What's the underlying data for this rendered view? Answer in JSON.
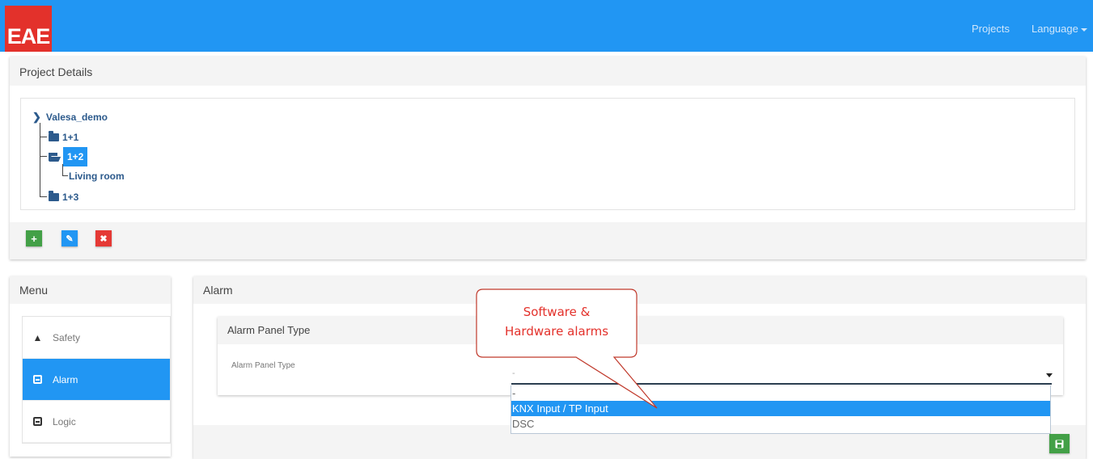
{
  "brand": {
    "logo_text": "EAE",
    "logo_color": "#e3312b",
    "navbar_color": "#2196f3"
  },
  "nav": {
    "projects": "Projects",
    "language": "Language"
  },
  "project_details": {
    "title": "Project Details",
    "tree": {
      "root": "Valesa_demo",
      "items": [
        {
          "label": "1+1"
        },
        {
          "label": "1+2",
          "selected": true
        },
        {
          "label": "Living room"
        },
        {
          "label": "1+3"
        }
      ]
    },
    "buttons": {
      "add": "+",
      "edit": "✎",
      "delete": "✖"
    }
  },
  "menu": {
    "title": "Menu",
    "items": [
      {
        "label": "Safety",
        "icon": "warning-icon"
      },
      {
        "label": "Alarm",
        "icon": "alarm-icon",
        "active": true
      },
      {
        "label": "Logic",
        "icon": "logic-icon"
      }
    ]
  },
  "alarm": {
    "title": "Alarm",
    "panel_title": "Alarm Panel Type",
    "field_label": "Alarm Panel Type",
    "selected_value": "-",
    "options": [
      "-",
      "KNX Input / TP Input",
      "DSC"
    ],
    "highlighted_option": "KNX Input / TP Input",
    "save_icon": "save-icon"
  },
  "callout": {
    "line1": "Software &",
    "line2": "Hardware alarms",
    "color": "#e3312b"
  }
}
